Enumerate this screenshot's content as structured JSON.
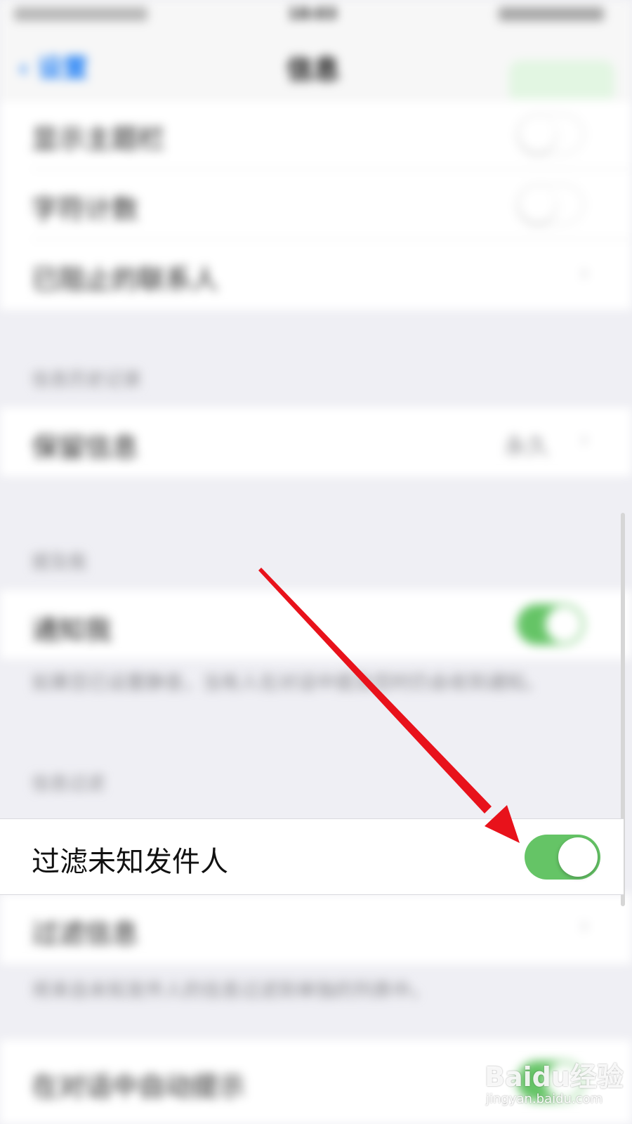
{
  "status_bar": {
    "time": "18:03"
  },
  "nav": {
    "back_label": "设置",
    "title": "信息"
  },
  "rows_top": [
    {
      "label": "显示主题栏"
    },
    {
      "label": "字符计数"
    },
    {
      "label": "已阻止的联系人"
    }
  ],
  "section_history": {
    "header": "信息历史记录",
    "row_label": "保留信息",
    "row_value": "永久"
  },
  "section_mention": {
    "header": "提及我",
    "row_label": "通知我",
    "footer": "如果您已设置静音，当有人在对话中提及您时仍会收到通知。"
  },
  "section_filter": {
    "header": "信息过滤",
    "highlight_label": "过滤未知发件人",
    "row_label": "过滤信息",
    "footer": "将来自未知发件人的信息过滤到单独的列表中。"
  },
  "section_bottom": {
    "row_label": "在对话中自动提示"
  },
  "toggle_state": {
    "filter_unknown_senders": true
  },
  "colors": {
    "toggle_green": "#65c466",
    "arrow_red": "#e8121b",
    "ios_blue": "#1a7cf5"
  },
  "watermark": {
    "brand": "Baidu经验",
    "url": "jingyan.baidu.com"
  }
}
